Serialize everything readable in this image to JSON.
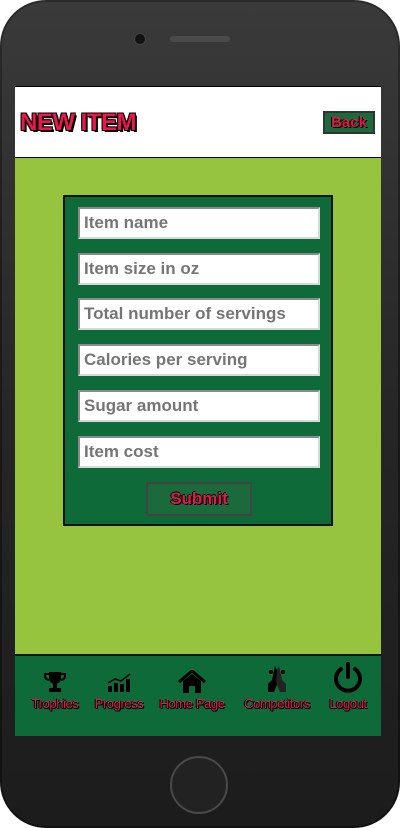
{
  "header": {
    "title": "NEW ITEM",
    "back_label": "Back"
  },
  "form": {
    "fields": [
      {
        "placeholder": "Item name"
      },
      {
        "placeholder": "Item size in oz"
      },
      {
        "placeholder": "Total number of servings"
      },
      {
        "placeholder": "Calories per serving"
      },
      {
        "placeholder": "Sugar amount"
      },
      {
        "placeholder": "Item cost"
      }
    ],
    "submit_label": "Submit"
  },
  "nav": {
    "items": [
      {
        "label": "Trophies",
        "icon": "trophy-icon"
      },
      {
        "label": "Progress",
        "icon": "progress-chart-icon"
      },
      {
        "label": "Home Page",
        "icon": "home-icon"
      },
      {
        "label": "Competitors",
        "icon": "handshake-icon"
      },
      {
        "label": "Logout",
        "icon": "power-icon"
      }
    ]
  },
  "colors": {
    "accent": "#e8194a",
    "background": "#96c43e",
    "panel": "#0e6a38"
  }
}
